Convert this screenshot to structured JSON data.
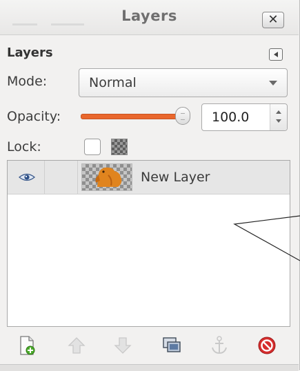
{
  "window": {
    "title": "Layers",
    "close_glyph": "✕"
  },
  "dock": {
    "header": "Layers",
    "menu_icon": "tab-menu-icon"
  },
  "mode": {
    "label": "Mode:",
    "value": "Normal"
  },
  "opacity": {
    "label": "Opacity:",
    "value": "100.0",
    "fill_percent": 100,
    "accent": "#e9672c"
  },
  "lock": {
    "label": "Lock:",
    "pixels_locked": false
  },
  "layers": [
    {
      "name": "New Layer",
      "visible": true,
      "chain": false
    }
  ],
  "toolbar": {
    "buttons": [
      {
        "icon": "new-layer-icon"
      },
      {
        "icon": "raise-layer-icon"
      },
      {
        "icon": "lower-layer-icon"
      },
      {
        "icon": "duplicate-layer-icon"
      },
      {
        "icon": "anchor-layer-icon"
      },
      {
        "icon": "delete-layer-icon"
      }
    ]
  },
  "colors": {
    "delete": "#d62d2d",
    "thumbnail_subject": "#e0841e"
  }
}
